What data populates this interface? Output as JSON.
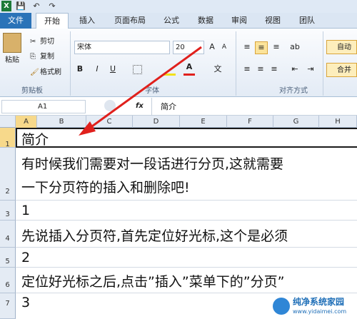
{
  "title_bar": {
    "quick_access": [
      "X",
      "💾",
      "↶",
      "↷"
    ]
  },
  "tabs": [
    "文件",
    "开始",
    "插入",
    "页面布局",
    "公式",
    "数据",
    "审阅",
    "视图",
    "团队"
  ],
  "clipboard": {
    "paste": "粘贴",
    "cut": "剪切",
    "copy": "复制",
    "format_painter": "格式刷",
    "group": "剪贴板"
  },
  "font": {
    "name": "宋体",
    "size": "20",
    "group": "字体",
    "bold": "B",
    "italic": "I",
    "underline": "U"
  },
  "alignment": {
    "group": "对齐方式",
    "wrap": "自动",
    "merge": "合并"
  },
  "formula_bar": {
    "name_box": "A1",
    "fx": "fx",
    "content": "简介"
  },
  "columns": [
    "A",
    "B",
    "C",
    "D",
    "E",
    "F",
    "G",
    "H"
  ],
  "rows": [
    {
      "num": "1",
      "text": "简介"
    },
    {
      "num": "2",
      "text": "有时候我们需要对一段话进行分页,这就需要",
      "text2": "一下分页符的插入和删除吧!"
    },
    {
      "num": "3",
      "text": "1"
    },
    {
      "num": "4",
      "text": "先说插入分页符,首先定位好光标,这个是必须"
    },
    {
      "num": "5",
      "text": "2"
    },
    {
      "num": "6",
      "text": "定位好光标之后,点击”插入”菜单下的”分页”"
    },
    {
      "num": "7",
      "text": "3"
    }
  ],
  "watermark": {
    "name": "纯净系统家园",
    "url": "www.yidaimei.com"
  },
  "colors": {
    "file_tab": "#2a73b8",
    "arrow": "#e0201c"
  }
}
